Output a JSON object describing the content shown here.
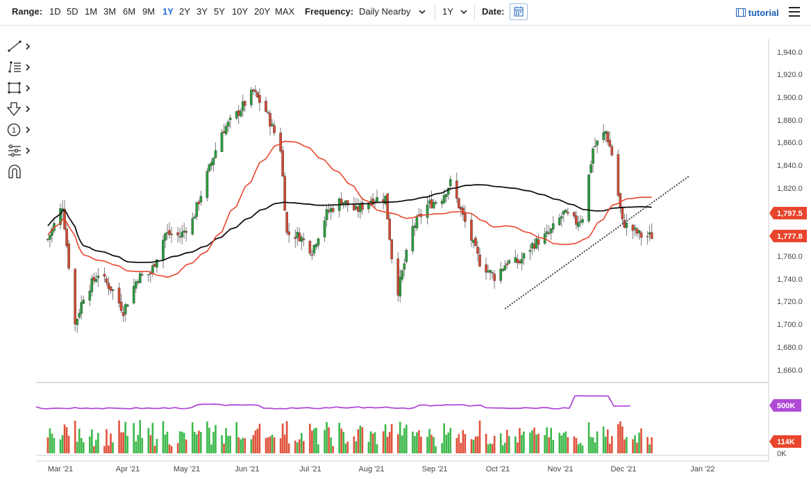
{
  "toolbar": {
    "range_label": "Range:",
    "ranges": [
      "1D",
      "5D",
      "1M",
      "3M",
      "6M",
      "9M",
      "1Y",
      "2Y",
      "3Y",
      "5Y",
      "10Y",
      "20Y",
      "MAX"
    ],
    "active_range": "1Y",
    "frequency_label": "Frequency:",
    "frequency_value": "Daily Nearby",
    "period_value": "1Y",
    "date_label": "Date:",
    "tutorial_label": "tutorial"
  },
  "side_tools": [
    "line-tool-icon",
    "fib-tool-icon",
    "rectangle-tool-icon",
    "arrow-tool-icon",
    "number-marker-icon",
    "measure-tool-icon",
    "magnet-icon"
  ],
  "chart_data": [
    {
      "type": "candlestick",
      "title": "",
      "x_tick_labels": [
        "Mar '21",
        "Apr '21",
        "May '21",
        "Jun '21",
        "Jul '21",
        "Aug '21",
        "Sep '21",
        "Oct '21",
        "Nov '21",
        "Dec '21",
        "Jan '22"
      ],
      "y_tick_labels": [
        "1,660.0",
        "1,680.0",
        "1,700.0",
        "1,720.0",
        "1,740.0",
        "1,760.0",
        "1,780.0",
        "1,800.0",
        "1,820.0",
        "1,840.0",
        "1,860.0",
        "1,880.0",
        "1,900.0",
        "1,920.0",
        "1,940.0"
      ],
      "ylim": [
        1650,
        1950
      ],
      "price_path": {
        "dates": [
          "2021-02-23",
          "2021-03-02",
          "2021-03-08",
          "2021-03-12",
          "2021-03-19",
          "2021-03-26",
          "2021-03-31",
          "2021-04-07",
          "2021-04-13",
          "2021-04-20",
          "2021-04-27",
          "2021-05-03",
          "2021-05-10",
          "2021-05-17",
          "2021-05-24",
          "2021-06-01",
          "2021-06-07",
          "2021-06-14",
          "2021-06-17",
          "2021-06-23",
          "2021-06-29",
          "2021-07-06",
          "2021-07-13",
          "2021-07-20",
          "2021-07-27",
          "2021-08-03",
          "2021-08-06",
          "2021-08-09",
          "2021-08-16",
          "2021-08-23",
          "2021-08-30",
          "2021-09-03",
          "2021-09-10",
          "2021-09-17",
          "2021-09-24",
          "2021-09-30",
          "2021-10-06",
          "2021-10-12",
          "2021-10-20",
          "2021-10-27",
          "2021-11-02",
          "2021-11-05",
          "2021-11-10",
          "2021-11-16",
          "2021-11-19",
          "2021-11-24",
          "2021-11-30",
          "2021-12-03",
          "2021-12-08"
        ],
        "closes": [
          1775,
          1805,
          1700,
          1725,
          1745,
          1730,
          1712,
          1742,
          1745,
          1780,
          1778,
          1792,
          1832,
          1870,
          1885,
          1905,
          1888,
          1855,
          1780,
          1778,
          1765,
          1798,
          1810,
          1800,
          1810,
          1812,
          1760,
          1730,
          1785,
          1805,
          1812,
          1825,
          1790,
          1755,
          1742,
          1755,
          1755,
          1770,
          1780,
          1798,
          1790,
          1795,
          1855,
          1870,
          1850,
          1790,
          1782,
          1778,
          1778
        ]
      },
      "indicators": {
        "sma_50": {
          "color": "#e8452c",
          "last_value": "1,797.5"
        },
        "sma_200": {
          "color": "#111111"
        }
      },
      "annotations": [
        "rising trendline (dashed) from early Oct '21 lows"
      ],
      "last_price": {
        "value": "1,777.8",
        "label_color": "#e8452c"
      },
      "ma_label": {
        "value": "1,797.5",
        "label_color": "#e8452c"
      }
    },
    {
      "type": "bar",
      "title": "",
      "series": [
        {
          "values_note": "daily volume, green up / red down"
        }
      ],
      "y_tick_labels": [
        "500K",
        "114K",
        "0K"
      ],
      "last_volume_label": "114K",
      "open_interest_label": "500K",
      "open_interest_color": "#b04ad6"
    }
  ]
}
